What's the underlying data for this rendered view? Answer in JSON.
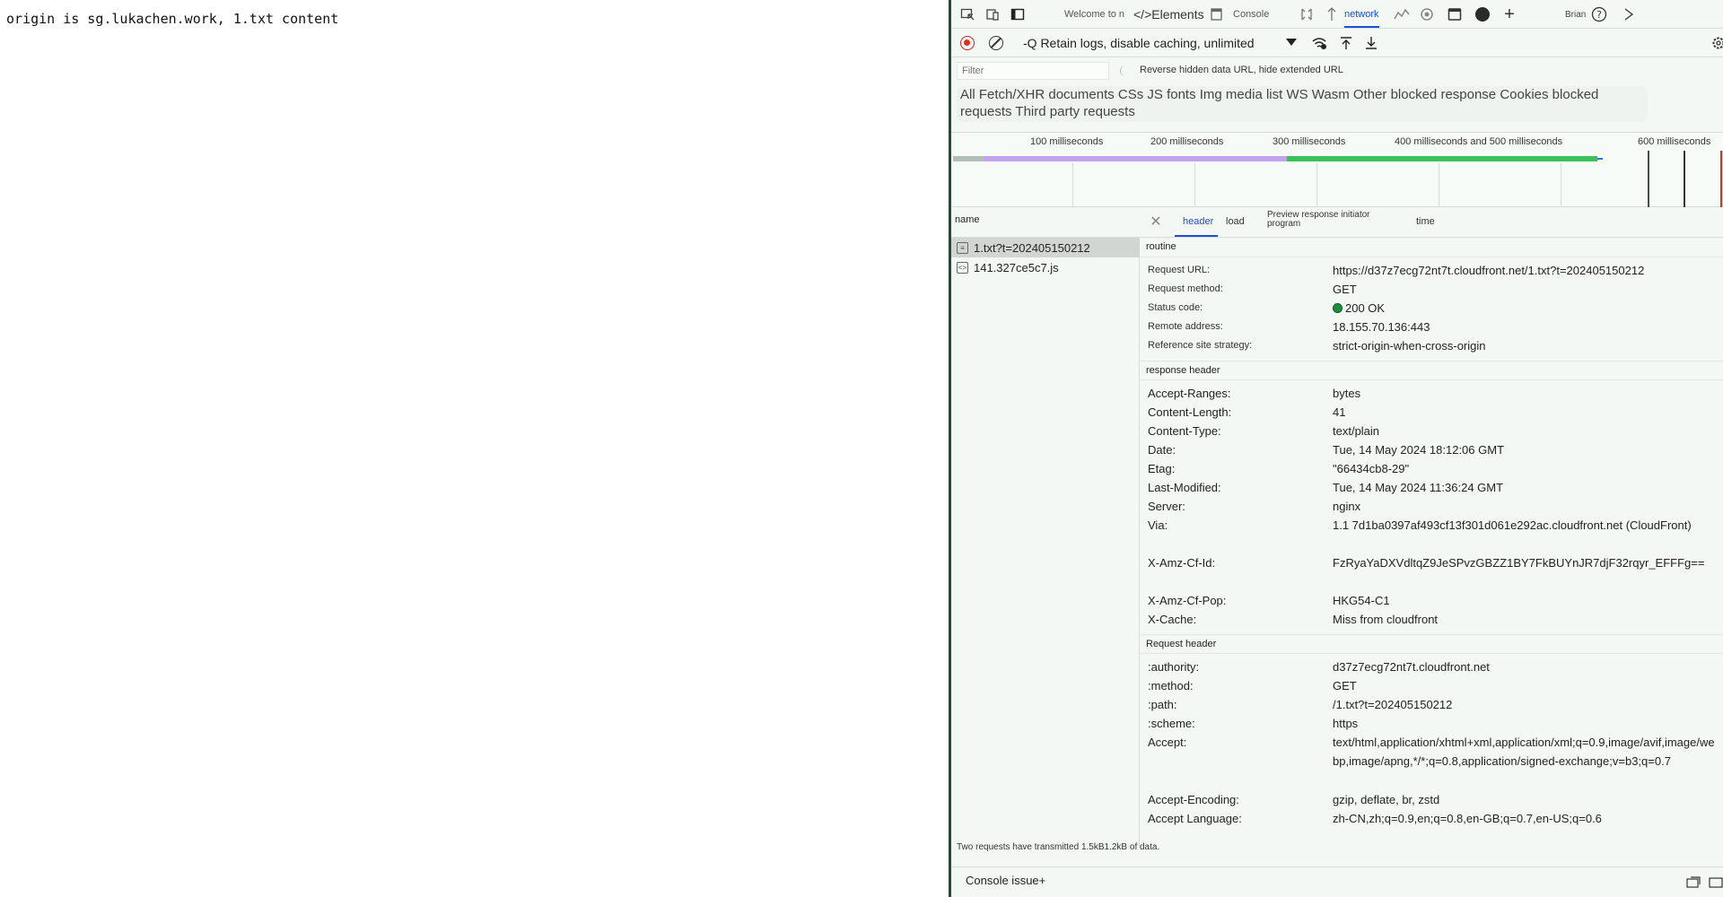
{
  "page": {
    "text": "origin is sg.lukachen.work, 1.txt content"
  },
  "devtools": {
    "tabs": [
      {
        "label": "Welcome to n"
      },
      {
        "label": "</>Elements"
      },
      {
        "label": "Console"
      },
      {
        "label": "network"
      }
    ],
    "corner_label": "Brian",
    "throttle_label": "-Q Retain logs, disable caching, unlimited",
    "filter_placeholder": "Filter",
    "filter_options": "Reverse hidden data URL, hide extended URL",
    "type_filters": "All Fetch/XHR documents CSs JS fonts Img media list WS Wasm Other blocked response Cookies blocked requests Third party requests",
    "timeline_ticks": [
      "100 milliseconds",
      "200 milliseconds",
      "300 milliseconds",
      "400 milliseconds and 500 milliseconds",
      "600 milliseconds"
    ],
    "name_header": "name",
    "requests": [
      {
        "name": "1.txt?t=202405150212"
      },
      {
        "name": "141.327ce5c7.js"
      }
    ],
    "detail_tabs": [
      {
        "label": "header"
      },
      {
        "label": "load"
      },
      {
        "label": "Preview response initiator program"
      },
      {
        "label": "time"
      }
    ],
    "general_title": "routine",
    "general": [
      {
        "k": "Request URL:",
        "v": "https://d37z7ecg72nt7t.cloudfront.net/1.txt?t=202405150212"
      },
      {
        "k": "Request method:",
        "v": "GET"
      },
      {
        "k": "Status code:",
        "v": "200 OK"
      },
      {
        "k": "Remote address:",
        "v": "18.155.70.136:443"
      },
      {
        "k": "Reference site strategy:",
        "v": "strict-origin-when-cross-origin"
      }
    ],
    "response_title": "response header",
    "response": [
      {
        "k": "Accept-Ranges:",
        "v": "bytes"
      },
      {
        "k": "Content-Length:",
        "v": "41"
      },
      {
        "k": "Content-Type:",
        "v": "text/plain"
      },
      {
        "k": "Date:",
        "v": "Tue, 14 May 2024 18:12:06 GMT"
      },
      {
        "k": "Etag:",
        "v": "\"66434cb8-29\""
      },
      {
        "k": "Last-Modified:",
        "v": "Tue, 14 May 2024 11:36:24 GMT"
      },
      {
        "k": "Server:",
        "v": "nginx"
      },
      {
        "k": "Via:",
        "v": "1.1 7d1ba0397af493cf13f301d061e292ac.cloudfront.net (CloudFront)"
      },
      {
        "k": "X-Amz-Cf-Id:",
        "v": "FzRyaYaDXVdltqZ9JeSPvzGBZZ1BY7FkBUYnJR7djF32rqyr_EFFFg=="
      },
      {
        "k": "X-Amz-Cf-Pop:",
        "v": "HKG54-C1"
      },
      {
        "k": "X-Cache:",
        "v": "Miss from cloudfront"
      }
    ],
    "request_title": "Request header",
    "request": [
      {
        "k": ":authority:",
        "v": "d37z7ecg72nt7t.cloudfront.net"
      },
      {
        "k": ":method:",
        "v": "GET"
      },
      {
        "k": ":path:",
        "v": "/1.txt?t=202405150212"
      },
      {
        "k": ":scheme:",
        "v": "https"
      },
      {
        "k": "Accept:",
        "v": "text/html,application/xhtml+xml,application/xml;q=0.9,image/avif,image/webp,image/apng,*/*;q=0.8,application/signed-exchange;v=b3;q=0.7"
      },
      {
        "k": "Accept-Encoding:",
        "v": "gzip, deflate, br, zstd"
      },
      {
        "k": "Accept Language:",
        "v": "zh-CN,zh;q=0.9,en;q=0.8,en-GB;q=0.7,en-US;q=0.6"
      }
    ],
    "summary": "Two requests have transmitted 1.5kB1.2kB of data.",
    "bottom_tab": "Console issue+"
  },
  "colors": {
    "accent": "#1a4fd6",
    "status_ok": "#1e8e3e",
    "record": "#d93025",
    "divider": "#1f4d38"
  }
}
